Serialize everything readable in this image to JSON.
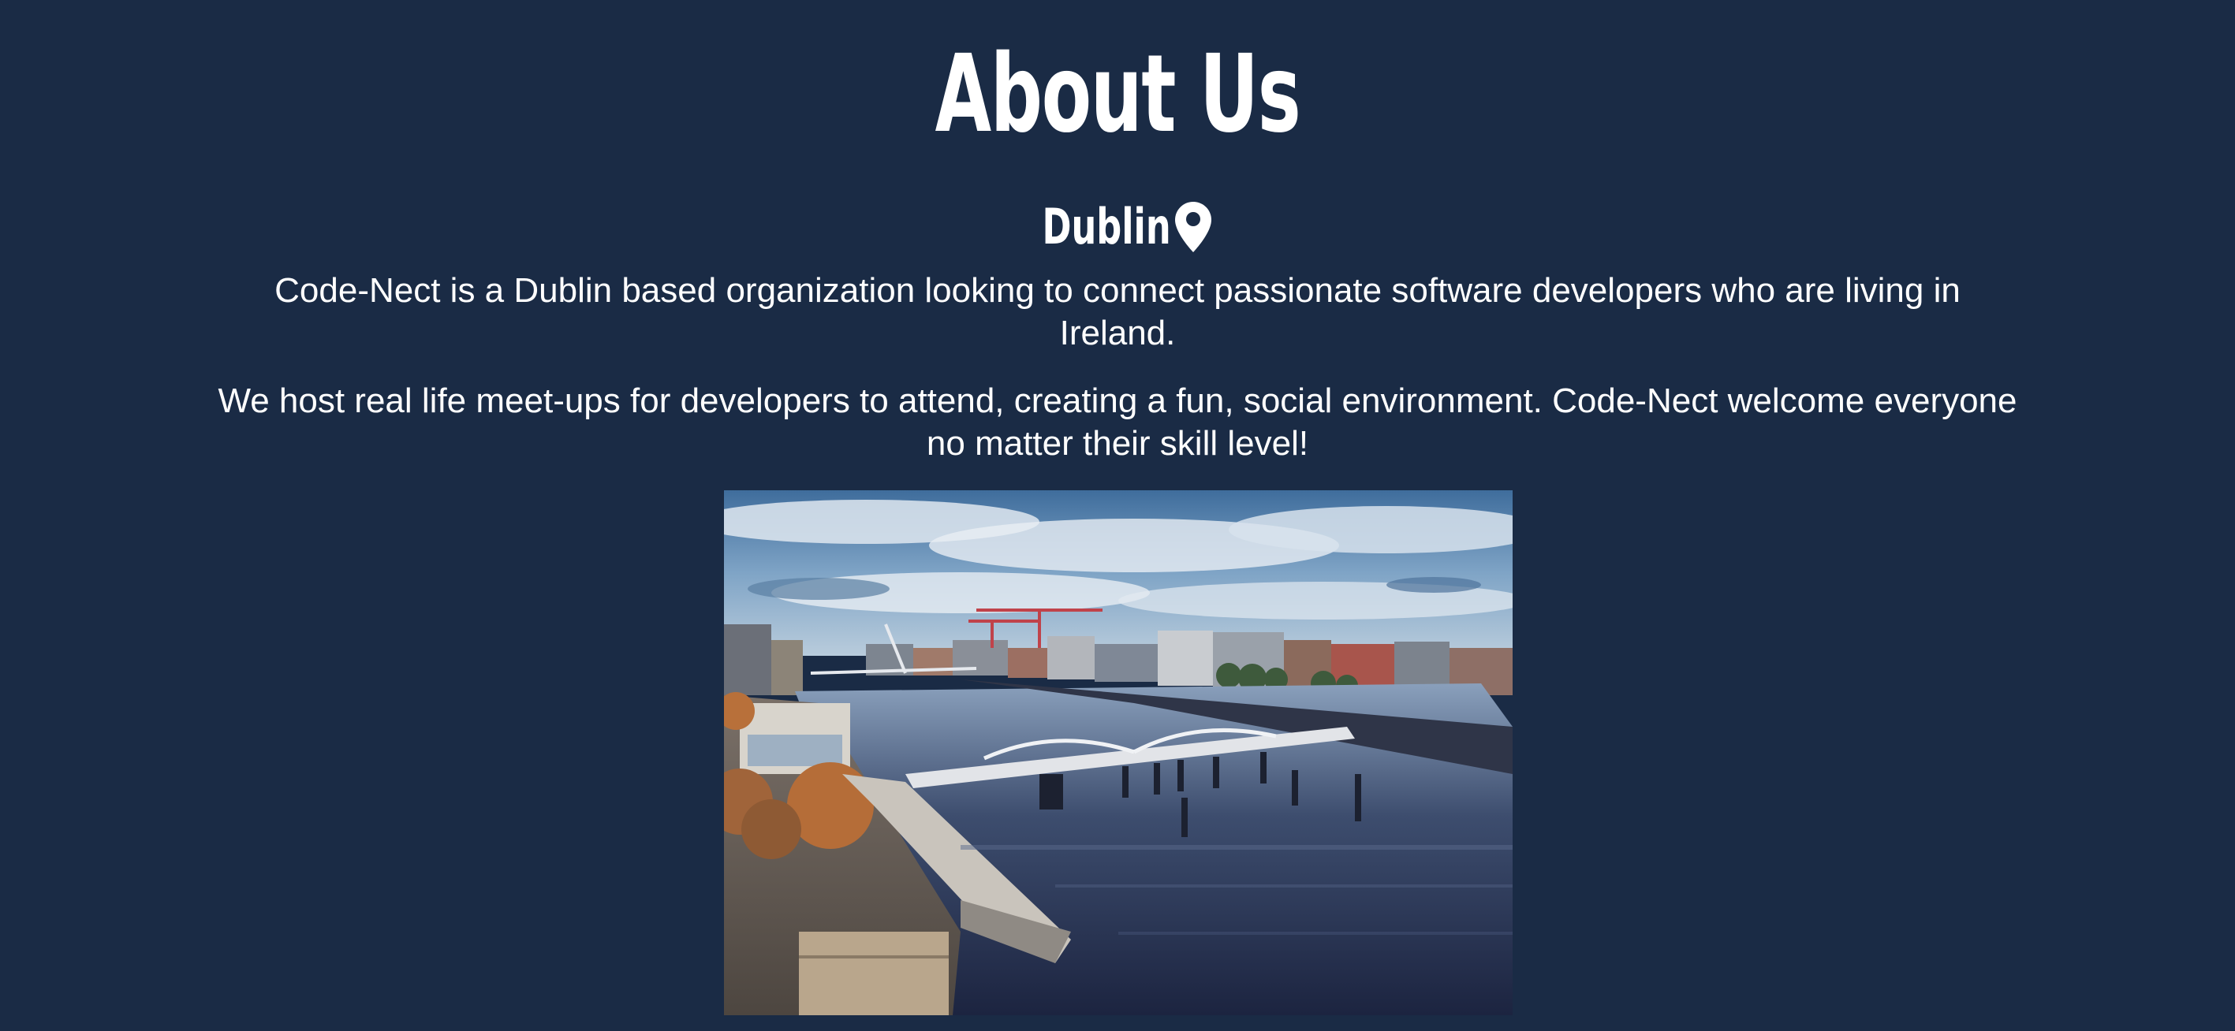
{
  "about": {
    "title": "About Us",
    "location": {
      "label": "Dublin",
      "icon": "map-pin-icon"
    },
    "paragraphs": [
      "Code-Nect is a Dublin based organization looking to connect passionate software developers who are living in Ireland.",
      "We host real life meet-ups for developers to attend, creating a fun, social environment. Code-Nect welcome everyone no matter their skill level!"
    ]
  },
  "colors": {
    "background": "#1a2b45",
    "text": "#ffffff"
  }
}
